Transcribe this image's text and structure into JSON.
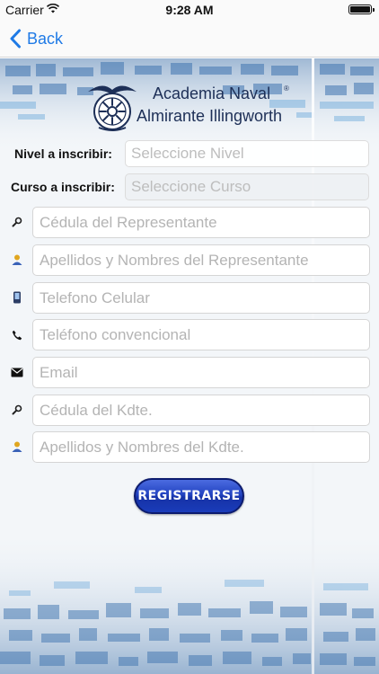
{
  "status_bar": {
    "carrier": "Carrier",
    "time": "9:28 AM"
  },
  "nav": {
    "back_label": "Back"
  },
  "header": {
    "title_line1": "Academia Naval",
    "title_line2": "Almirante Illingworth",
    "reg_mark": "®"
  },
  "form": {
    "nivel": {
      "label": "Nivel a inscribir:",
      "placeholder": "Seleccione Nivel"
    },
    "curso": {
      "label": "Curso a inscribir:",
      "placeholder": "Seleccione Curso"
    },
    "fields": [
      {
        "icon": "search-icon",
        "placeholder": "Cédula del Representante"
      },
      {
        "icon": "user-icon",
        "placeholder": "Apellidos y Nombres del Representante"
      },
      {
        "icon": "mobile-phone-icon",
        "placeholder": "Telefono Celular"
      },
      {
        "icon": "phone-icon",
        "placeholder": "Teléfono convencional"
      },
      {
        "icon": "envelope-icon",
        "placeholder": "Email"
      },
      {
        "icon": "search-icon",
        "placeholder": "Cédula del Kdte."
      },
      {
        "icon": "user-icon",
        "placeholder": "Apellidos y Nombres del Kdte."
      }
    ]
  },
  "register_button": {
    "label": "REGISTRARSE"
  },
  "colors": {
    "accent": "#1f7ae6",
    "button": "#2344c2",
    "title": "#1d2f57"
  }
}
